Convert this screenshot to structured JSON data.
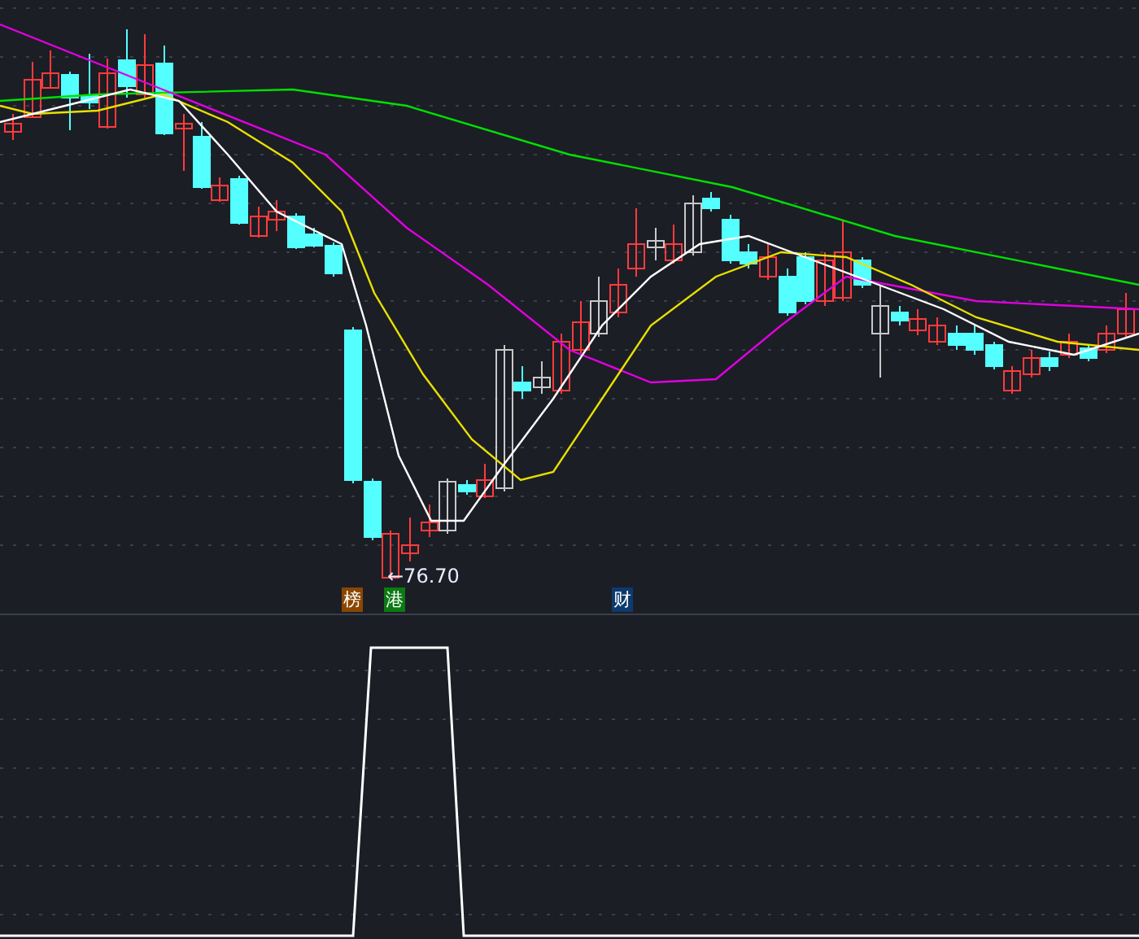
{
  "price_chart": {
    "low_price": {
      "label": "←76.70"
    },
    "markers": [
      {
        "label": "榜",
        "color": "#8a4600"
      },
      {
        "label": "港",
        "color": "#0b7a12"
      },
      {
        "label": "财",
        "color": "#0d3a6e"
      }
    ]
  }
}
